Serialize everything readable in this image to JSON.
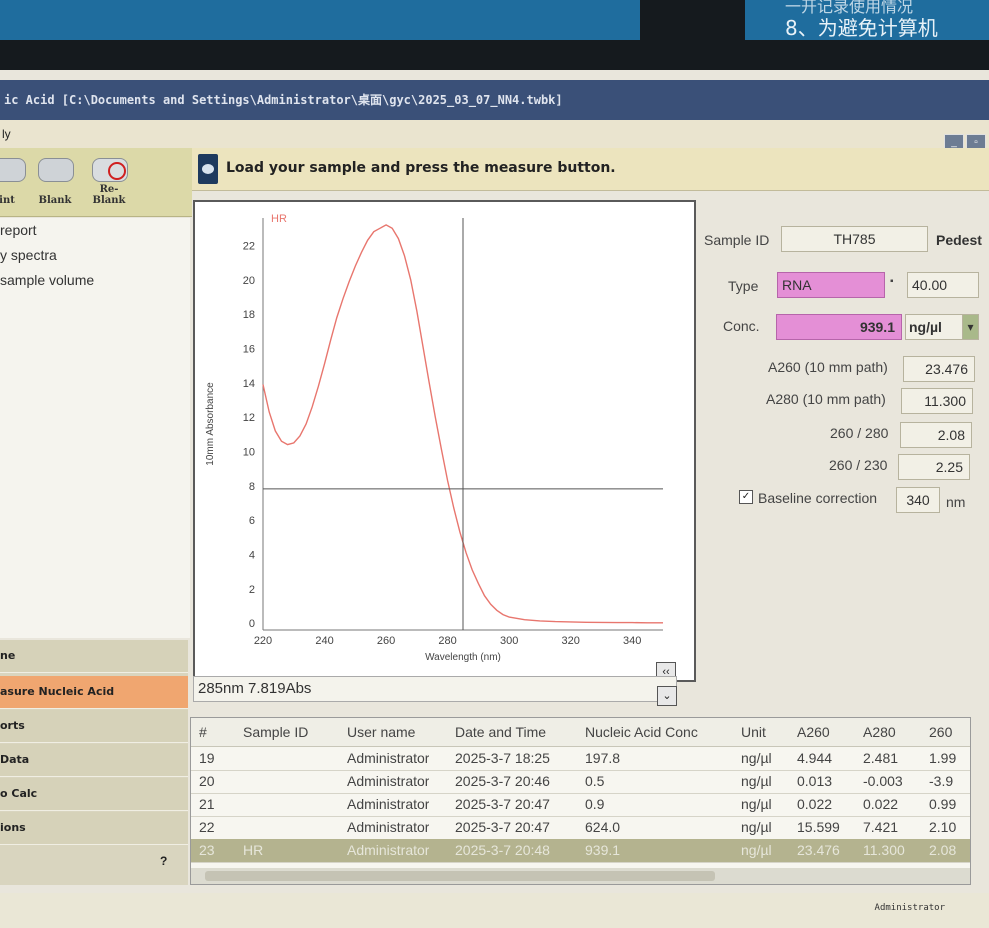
{
  "background": {
    "other_window_right_text": "8、为避免计算机",
    "other_window_top_right": "一开记录使用情况"
  },
  "window": {
    "title": "ic Acid  [C:\\Documents and Settings\\Administrator\\桌面\\gyc\\2025_03_07_NN4.twbk]",
    "menu": "ly",
    "minimize_label": "_",
    "restore_label": "▫"
  },
  "toolbar": {
    "buttons": [
      {
        "label": "int",
        "icon": "printer-icon"
      },
      {
        "label": "Blank",
        "icon": "blank-icon"
      },
      {
        "label": "Re-Blank",
        "icon": "reblank-icon"
      }
    ]
  },
  "left_list": [
    "report",
    "y spectra",
    "sample volume"
  ],
  "nav": {
    "items": [
      "ne",
      "asure Nucleic Acid",
      "orts",
      "Data",
      "o Calc",
      "ions"
    ],
    "active_index": 1,
    "collapse_label": "?"
  },
  "instruction": "Load your sample and press the measure button.",
  "chart_data": {
    "type": "line",
    "series": [
      {
        "name": "HR",
        "color": "#e8766e",
        "x": [
          220,
          222,
          224,
          226,
          228,
          230,
          232,
          234,
          236,
          238,
          240,
          242,
          244,
          246,
          248,
          250,
          252,
          254,
          256,
          258,
          260,
          262,
          264,
          266,
          268,
          270,
          272,
          274,
          276,
          278,
          280,
          282,
          284,
          286,
          288,
          290,
          292,
          294,
          296,
          298,
          300,
          305,
          310,
          315,
          320,
          325,
          330,
          335,
          340,
          345,
          350
        ],
        "y": [
          13.9,
          12.3,
          11.2,
          10.6,
          10.4,
          10.5,
          10.9,
          11.6,
          12.6,
          13.8,
          15.1,
          16.5,
          17.8,
          18.9,
          19.9,
          20.8,
          21.6,
          22.3,
          22.8,
          23.0,
          23.2,
          23.0,
          22.4,
          21.4,
          20.0,
          18.2,
          16.1,
          14.0,
          12.0,
          10.1,
          8.3,
          6.7,
          5.3,
          4.1,
          3.1,
          2.3,
          1.6,
          1.1,
          0.75,
          0.5,
          0.35,
          0.2,
          0.13,
          0.09,
          0.07,
          0.05,
          0.04,
          0.03,
          0.03,
          0.02,
          0.02
        ]
      }
    ],
    "xlabel": "Wavelength (nm)",
    "ylabel": "10mm Absorbance",
    "xlim": [
      220,
      350
    ],
    "ylim": [
      -0.4,
      23.6
    ],
    "xticks": [
      220,
      240,
      260,
      280,
      300,
      320,
      340
    ],
    "yticks": [
      0,
      2,
      4,
      6,
      8,
      10,
      12,
      14,
      16,
      18,
      20,
      22
    ],
    "cursor": {
      "x": 285,
      "y": 7.819
    }
  },
  "readout": "285nm 7.819Abs",
  "sample": {
    "id_label": "Sample ID",
    "id_value": "TH785",
    "pedestal_label": "Pedest",
    "type_label": "Type",
    "type_value": "RNA",
    "type_arrow": "▪",
    "factor_value": "40.00",
    "conc_label": "Conc.",
    "conc_value": "939.1",
    "conc_unit": "ng/µl",
    "unit_arrow": "▾",
    "a260_label": "A260 (10 mm path)",
    "a260_value": "23.476",
    "a280_label": "A280 (10 mm path)",
    "a280_value": "11.300",
    "r260_280_label": "260 / 280",
    "r260_280_value": "2.08",
    "r260_230_label": "260 / 230",
    "r260_230_value": "2.25",
    "baseline_label": "Baseline correction",
    "baseline_checked": true,
    "baseline_value": "340",
    "baseline_unit": "nm"
  },
  "table": {
    "headers": [
      "#",
      "Sample ID",
      "User name",
      "Date and Time",
      "Nucleic Acid Conc",
      "Unit",
      "A260",
      "A280",
      "260"
    ],
    "rows": [
      [
        "19",
        "",
        "Administrator",
        "2025-3-7 18:25",
        "197.8",
        "ng/µl",
        "4.944",
        "2.481",
        "1.99"
      ],
      [
        "20",
        "",
        "Administrator",
        "2025-3-7 20:46",
        "0.5",
        "ng/µl",
        "0.013",
        "-0.003",
        "-3.9"
      ],
      [
        "21",
        "",
        "Administrator",
        "2025-3-7 20:47",
        "0.9",
        "ng/µl",
        "0.022",
        "0.022",
        "0.99"
      ],
      [
        "22",
        "",
        "Administrator",
        "2025-3-7 20:47",
        "624.0",
        "ng/µl",
        "15.599",
        "7.421",
        "2.10"
      ],
      [
        "23",
        "HR",
        "Administrator",
        "2025-3-7 20:48",
        "939.1",
        "ng/µl",
        "23.476",
        "11.300",
        "2.08"
      ]
    ],
    "selected_row": 4
  },
  "status": {
    "user": "Administrator"
  }
}
